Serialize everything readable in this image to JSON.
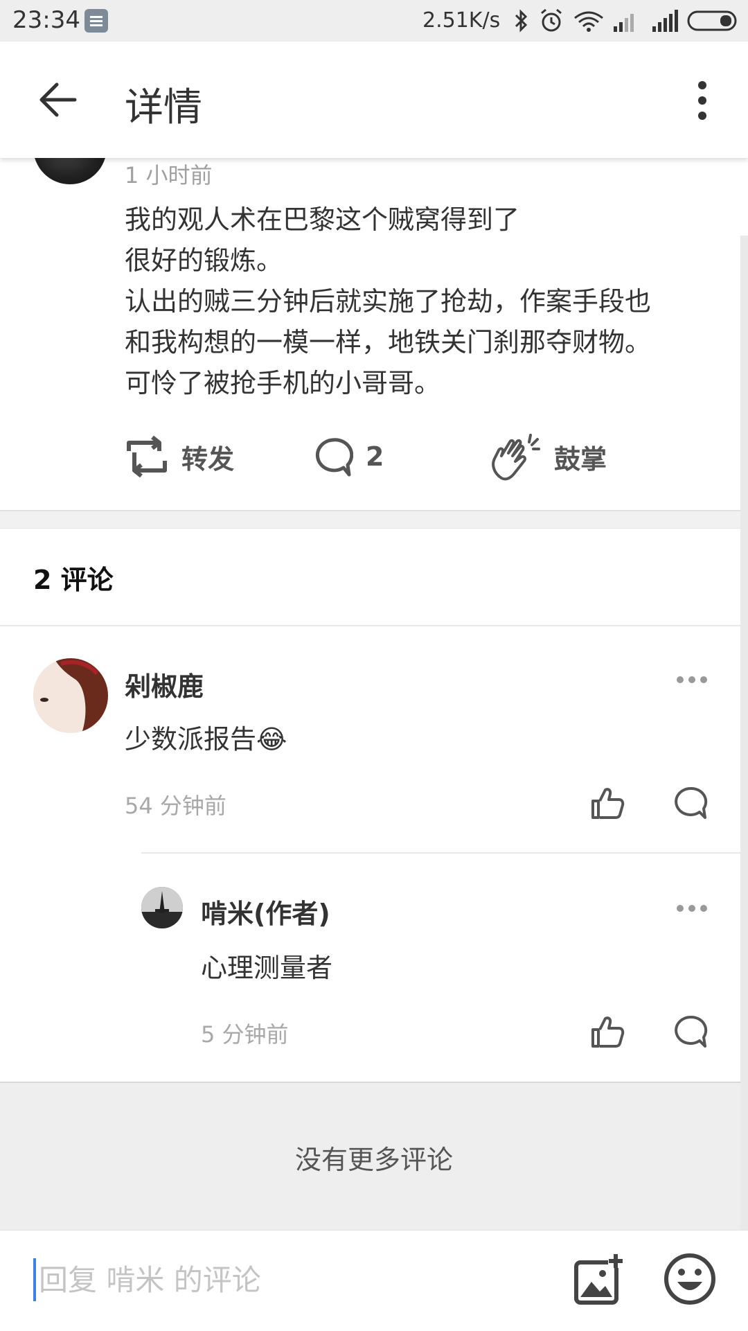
{
  "status_bar": {
    "time": "23:34",
    "network_speed": "2.51K/s",
    "icons": [
      "notification-icon",
      "bluetooth-icon",
      "alarm-icon",
      "wifi-icon",
      "signal-icon",
      "signal-icon",
      "battery-icon"
    ]
  },
  "header": {
    "title": "详情",
    "back_icon": "arrow-left-icon",
    "menu_icon": "more-vertical-icon"
  },
  "post": {
    "time": "1 小时前",
    "body_lines": [
      "我的观人术在巴黎这个贼窝得到了",
      "很好的锻炼。",
      "认出的贼三分钟后就实施了抢劫，作案手段也",
      "和我构想的一模一样，地铁关门刹那夺财物。",
      "可怜了被抢手机的小哥哥。"
    ],
    "actions": {
      "repost_label": "转发",
      "comment_count": "2",
      "clap_label": "鼓掌"
    }
  },
  "comments": {
    "header": "2 评论",
    "items": [
      {
        "name": "剁椒鹿",
        "text": "少数派报告😂",
        "time": "54 分钟前"
      }
    ],
    "reply": {
      "name": "啃米(作者)",
      "text": "心理测量者",
      "time": "5 分钟前"
    }
  },
  "footer": {
    "no_more": "没有更多评论"
  },
  "reply_bar": {
    "placeholder": "回复 啃米 的评论",
    "image_icon": "add-image-icon",
    "emoji_icon": "emoji-icon"
  }
}
